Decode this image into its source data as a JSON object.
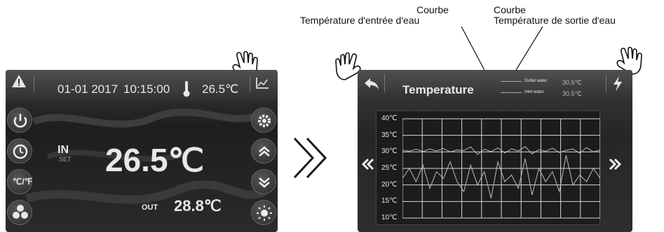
{
  "annotations": {
    "inlet_curve": {
      "line1": "Courbe",
      "line2": "Température d'entrée d'eau"
    },
    "outlet_curve": {
      "line1": "Courbe",
      "line2": "Température de sortie d'eau"
    }
  },
  "home_screen": {
    "date": "01-01 2017",
    "time": "10:15:00",
    "ambient_temp": "26.5℃",
    "in_label": "IN",
    "set_label": "SET",
    "main_temp": "26.5℃",
    "out_label": "OUT",
    "out_temp": "28.8℃",
    "unit_toggle": "℃/℉"
  },
  "temp_screen": {
    "title": "Temperature",
    "legend": [
      {
        "label": "Outlet water",
        "value": "30.5℃"
      },
      {
        "label": "Inlet water",
        "value": "30.5℃"
      }
    ]
  },
  "colors": {
    "screen_bg": "#262626",
    "text": "#e8e8e8",
    "grid": "#d8d8d8",
    "curve": "#bdbdbd"
  },
  "chart_data": {
    "type": "line",
    "y_ticks": [
      "40℃",
      "35℃",
      "30℃",
      "25℃",
      "20℃",
      "15℃",
      "10℃"
    ],
    "ylim": [
      10,
      40
    ],
    "grid": true,
    "series": [
      {
        "values": [
          30.5,
          30.2,
          30.8,
          30.1,
          30.9,
          30.3,
          31.0,
          30.0,
          30.6,
          30.4,
          31.5,
          29.2,
          30.8,
          30.1,
          31.2,
          29.7,
          30.9,
          30.3,
          31.6,
          29.4,
          30.7,
          30.2,
          31.1,
          29.8,
          30.5,
          30.9,
          29.6,
          31.3,
          30.0,
          30.6
        ]
      },
      {
        "values": [
          22,
          25,
          21,
          26,
          19,
          24,
          22,
          27,
          21,
          18,
          26,
          20,
          24,
          16,
          27,
          21,
          23,
          19,
          28,
          17,
          25,
          21,
          24,
          18,
          29,
          20,
          23,
          21,
          25,
          22
        ]
      }
    ]
  }
}
